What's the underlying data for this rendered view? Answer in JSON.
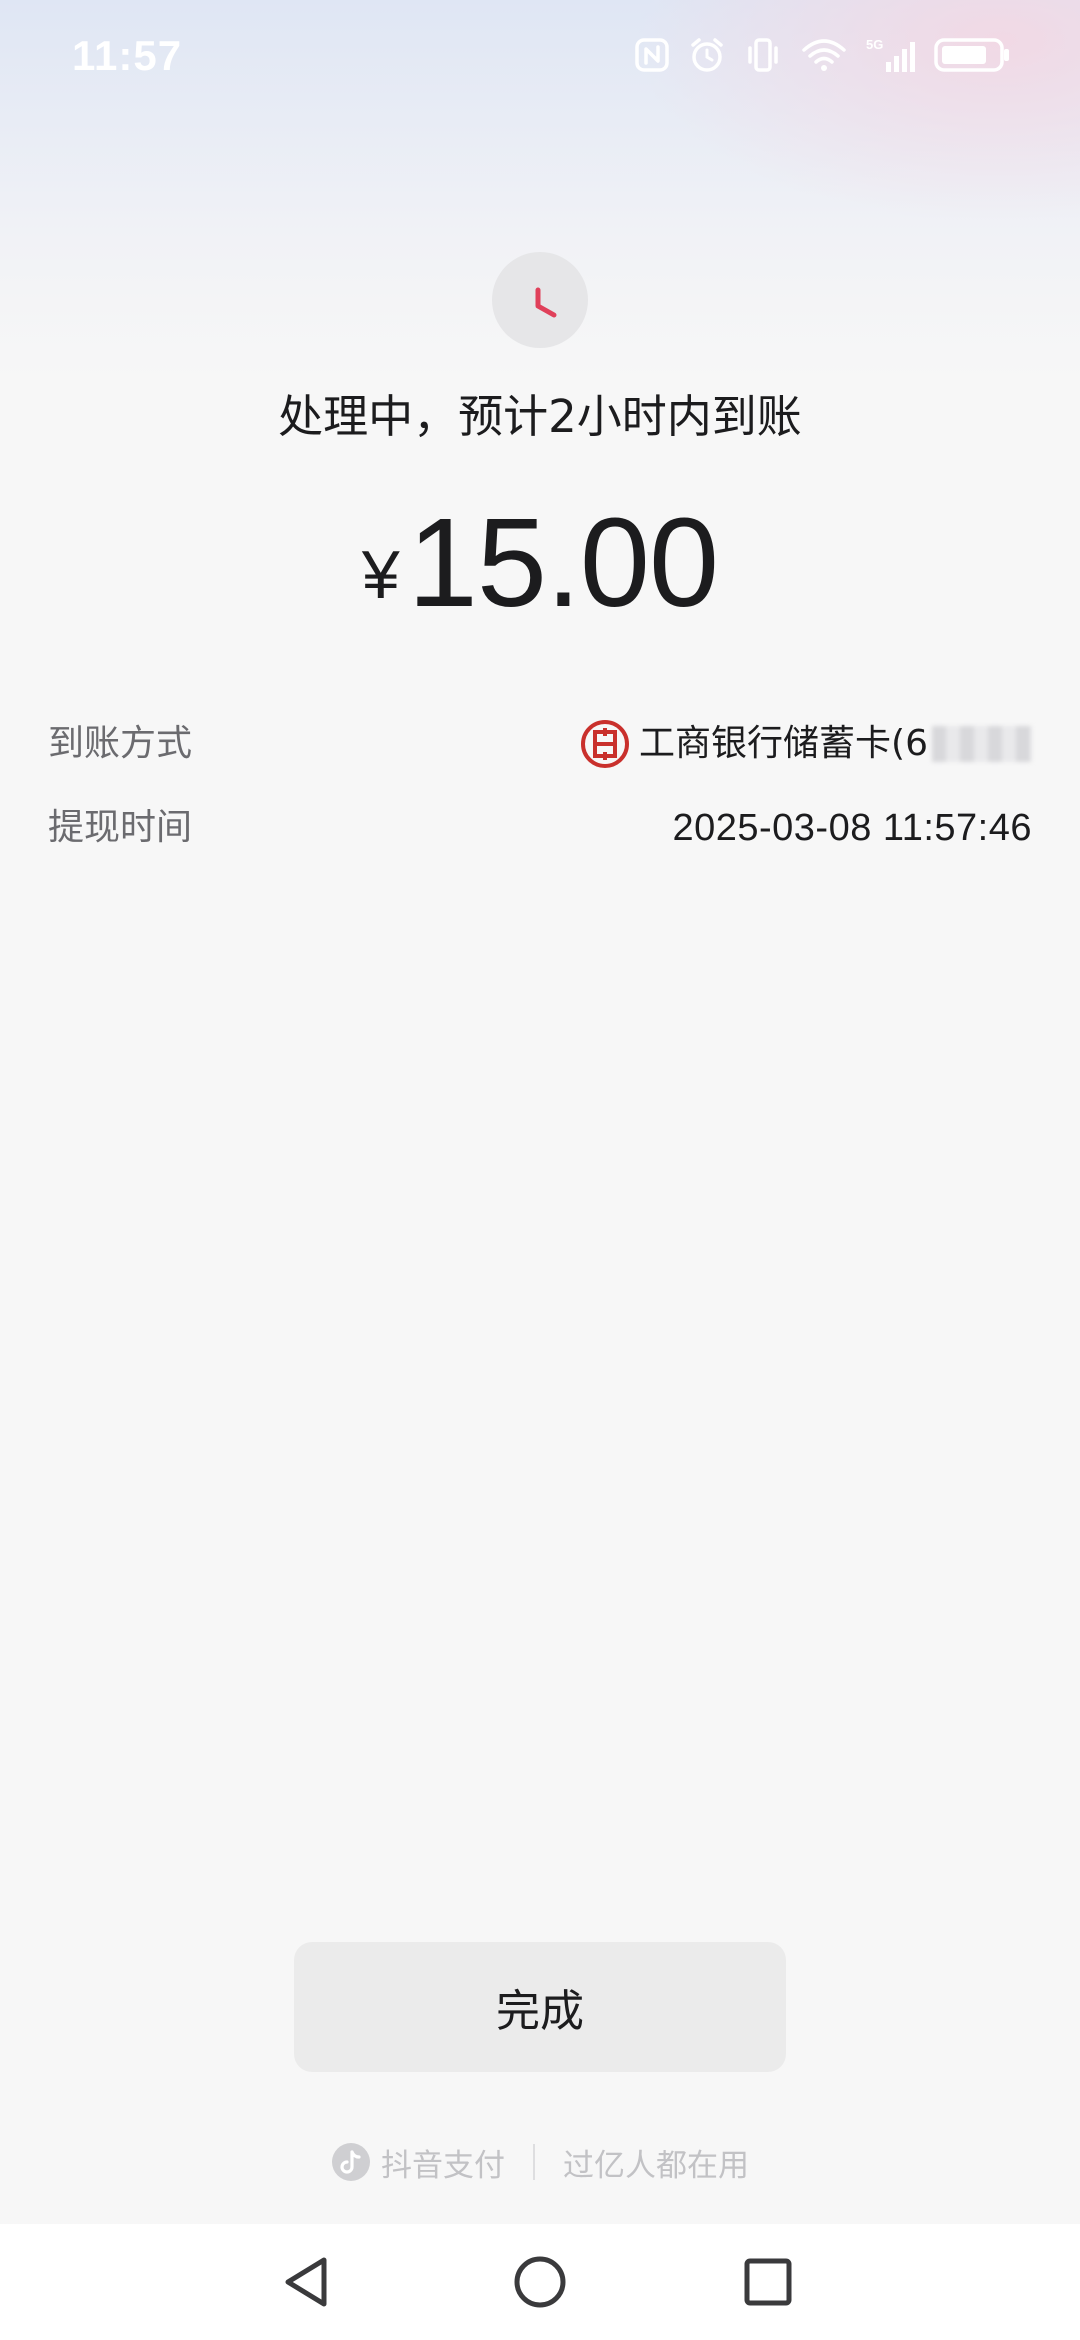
{
  "status_bar": {
    "time": "11:57",
    "icons": [
      "nfc-icon",
      "alarm-icon",
      "vibrate-icon",
      "wifi-icon",
      "5g-signal-icon",
      "battery-icon"
    ]
  },
  "result": {
    "icon": "clock-icon",
    "accent_color": "#e0405a",
    "title": "处理中，预计2小时内到账",
    "currency_symbol": "¥",
    "amount": "15.00"
  },
  "details": [
    {
      "label": "到账方式",
      "value": "工商银行储蓄卡(6",
      "icon": "icbc-logo-icon",
      "icon_color": "#c9302c"
    },
    {
      "label": "提现时间",
      "value": "2025-03-08 11:57:46"
    }
  ],
  "actions": {
    "done_label": "完成"
  },
  "footer": {
    "brand": "抖音支付",
    "slogan": "过亿人都在用"
  },
  "navigation": {
    "icons": [
      "back-icon",
      "home-icon",
      "recents-icon"
    ]
  }
}
